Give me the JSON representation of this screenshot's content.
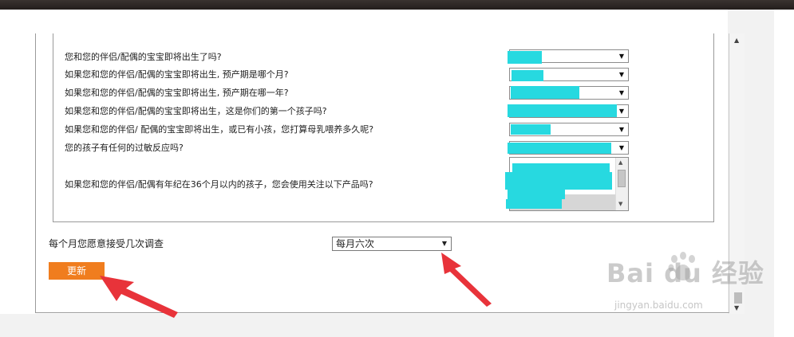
{
  "questions": [
    {
      "text": "您和您的伴侣/配偶的宝宝即将出生了吗?"
    },
    {
      "text": "如果您和您的伴侣/配偶的宝宝即将出生, 预产期是哪个月?"
    },
    {
      "text": "如果您和您的伴侣/配偶的宝宝即将出生, 预产期在哪一年?"
    },
    {
      "text": "如果您和您的伴侣/配偶的宝宝即将出生，这是你们的第一个孩子吗?"
    },
    {
      "text": "如果您和您的伴侣/ 配偶的宝宝即将出生，或已有小孩，您打算母乳喂养多久呢?"
    },
    {
      "text": "您的孩子有任何的过敏反应吗?"
    },
    {
      "text": "如果您和您的伴侣/配偶有年纪在36个月以内的孩子，您会使用关注以下产品吗?"
    }
  ],
  "survey_frequency": {
    "label": "每个月您愿意接受几次调查",
    "selected": "每月六次"
  },
  "update_button": {
    "label": "更新"
  },
  "watermark": {
    "logo": "Bai du 经验",
    "sub": "jingyan.baidu.com"
  },
  "colors": {
    "mask": "#27d9e0",
    "button": "#f07d1e",
    "arrow": "#e8333a"
  },
  "icons": {
    "dropdown": "dropdown-arrow-icon",
    "annotation": "red-arrow-icon"
  }
}
